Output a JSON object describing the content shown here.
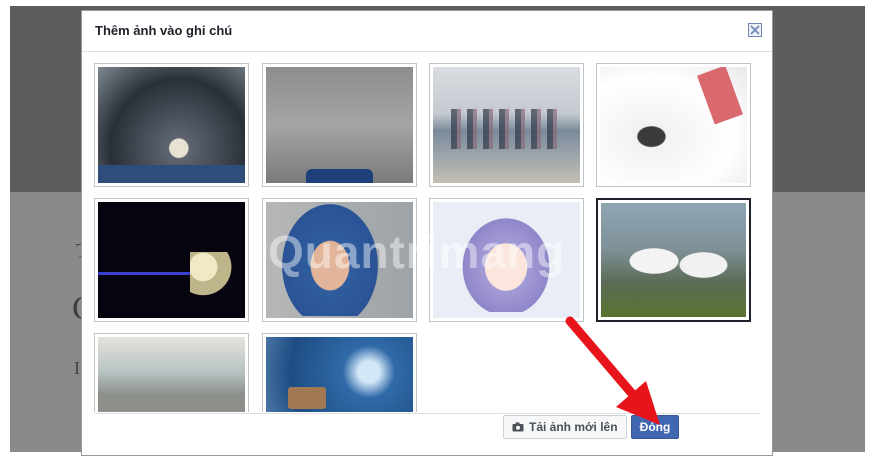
{
  "dialog": {
    "title": "Thêm ảnh vào ghi chú",
    "close_icon": "close-icon"
  },
  "photos": [
    {
      "label": "photo-feet-on-rocks",
      "selected": false
    },
    {
      "label": "photo-feet-blurred",
      "selected": false
    },
    {
      "label": "photo-beach-crowd",
      "selected": false
    },
    {
      "label": "photo-white-hood",
      "selected": false
    },
    {
      "label": "photo-giraffe-toy",
      "selected": false
    },
    {
      "label": "photo-child-blue-hood",
      "selected": false
    },
    {
      "label": "photo-anime-girl",
      "selected": false
    },
    {
      "label": "photo-two-people-raincoats",
      "selected": true
    },
    {
      "label": "photo-wave-sand",
      "selected": false
    },
    {
      "label": "photo-bokeh-blue",
      "selected": false
    }
  ],
  "footer": {
    "upload_label": "Tải ảnh mới lên",
    "upload_icon": "camera-icon",
    "close_label": "Đóng"
  },
  "watermark": {
    "text": "Quantrimang"
  },
  "colors": {
    "primary_button": "#4267b2",
    "annotation_arrow": "#e8141b"
  }
}
